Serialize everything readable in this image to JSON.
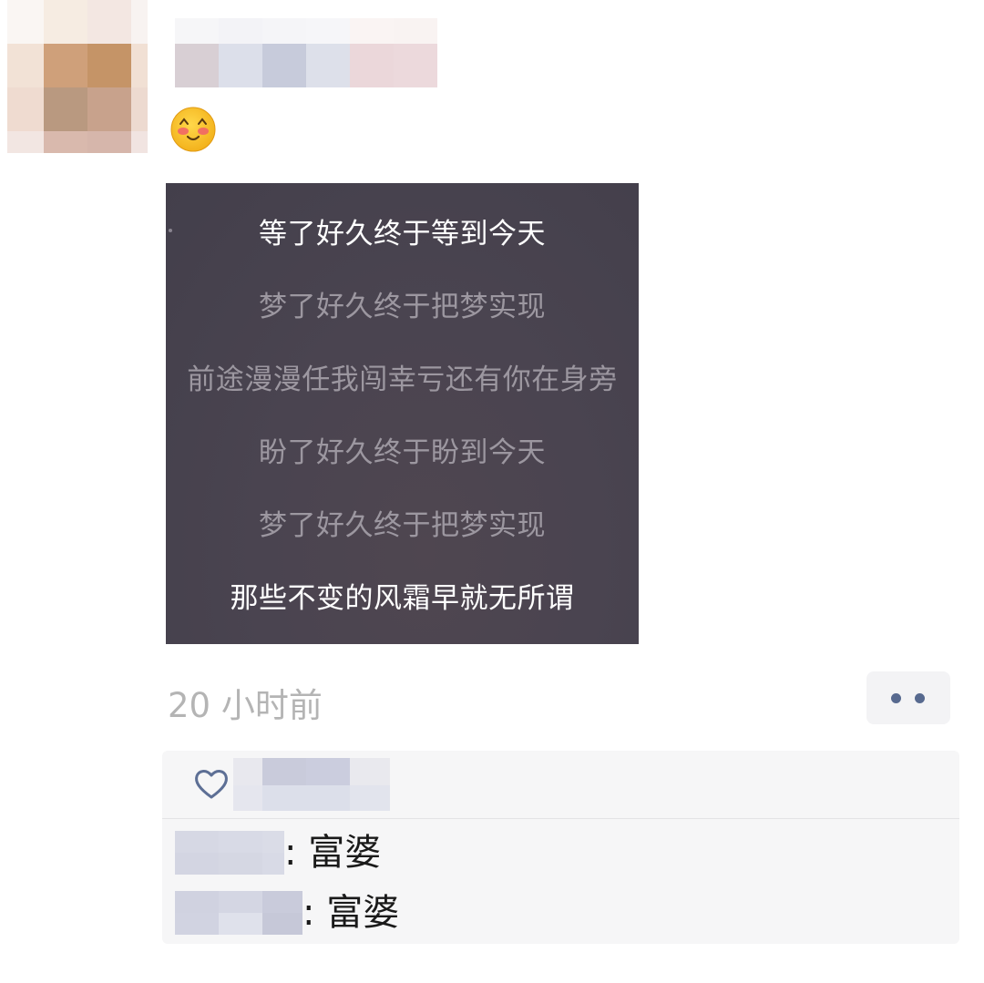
{
  "post": {
    "lyrics": [
      {
        "text": "等了好久终于等到今天",
        "style": "bright"
      },
      {
        "text": "梦了好久终于把梦实现",
        "style": "dim"
      },
      {
        "text": "前途漫漫任我闯幸亏还有你在身旁",
        "style": "dim"
      },
      {
        "text": "盼了好久终于盼到今天",
        "style": "dim"
      },
      {
        "text": "梦了好久终于把梦实现",
        "style": "dim"
      },
      {
        "text": "那些不变的风霜早就无所谓",
        "style": "bright"
      }
    ],
    "timestamp": "20 小时前",
    "emoji_icon": "blushing-smile-emoji"
  },
  "actions": {
    "more_icon": "two-dots-icon"
  },
  "interactions": {
    "like_icon": "heart-outline-icon",
    "comments": [
      {
        "text": ": 富婆"
      },
      {
        "text": ": 富婆"
      }
    ]
  },
  "colors": {
    "lyric_bg": "#48434e",
    "lyric_dim": "#9c97a0",
    "lyric_bright": "#ffffff",
    "timestamp": "#b4b4b4",
    "action_dot": "#57698f",
    "panel_bg": "#f6f6f7"
  }
}
